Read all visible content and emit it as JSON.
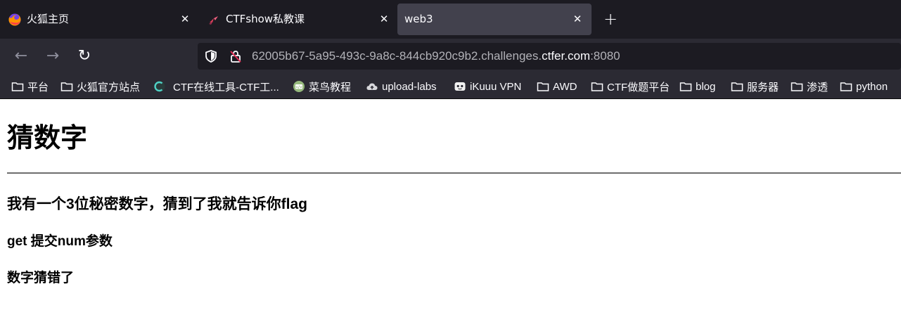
{
  "tabs": [
    {
      "title": "火狐主页",
      "favicon": "firefox-icon"
    },
    {
      "title": "CTFshow私教课",
      "favicon": "ctfshow-icon"
    },
    {
      "title": "web3",
      "favicon": "none",
      "active": true
    }
  ],
  "tab_close_glyph": "✕",
  "new_tab_glyph": "+",
  "nav": {
    "back": "←",
    "forward": "→",
    "reload": "↻"
  },
  "url": {
    "prefix": "62005b67-5a95-493c-9a8c-844cb920c9b2.challenges.",
    "domain": "ctfer.com",
    "suffix": ":8080"
  },
  "bookmarks": [
    {
      "label": "平台",
      "icon": "folder-icon"
    },
    {
      "label": "火狐官方站点",
      "icon": "folder-icon"
    },
    {
      "label": "CTF在线工具-CTF工...",
      "icon": "ctftools-icon"
    },
    {
      "label": "菜鸟教程",
      "icon": "runoob-icon"
    },
    {
      "label": "upload-labs",
      "icon": "cloud-icon"
    },
    {
      "label": "iKuuu VPN",
      "icon": "ikuuu-icon"
    },
    {
      "label": "AWD",
      "icon": "folder-icon"
    },
    {
      "label": "CTF做题平台",
      "icon": "folder-icon"
    },
    {
      "label": "blog",
      "icon": "folder-icon"
    },
    {
      "label": "服务器",
      "icon": "folder-icon"
    },
    {
      "label": "渗透",
      "icon": "folder-icon"
    },
    {
      "label": "python",
      "icon": "folder-icon"
    }
  ],
  "page": {
    "heading": "猜数字",
    "subheading": "我有一个3位秘密数字，猜到了我就告诉你flag",
    "instruction": "get 提交num参数",
    "result": "数字猜错了"
  },
  "colors": {
    "tabstrip_bg": "#1c1b22",
    "active_tab_bg": "#42414d",
    "toolbar_bg": "#2b2a33",
    "url_field_bg": "#1c1b22",
    "text_light": "#fbfbfe",
    "text_dim": "#b2b2b8"
  }
}
